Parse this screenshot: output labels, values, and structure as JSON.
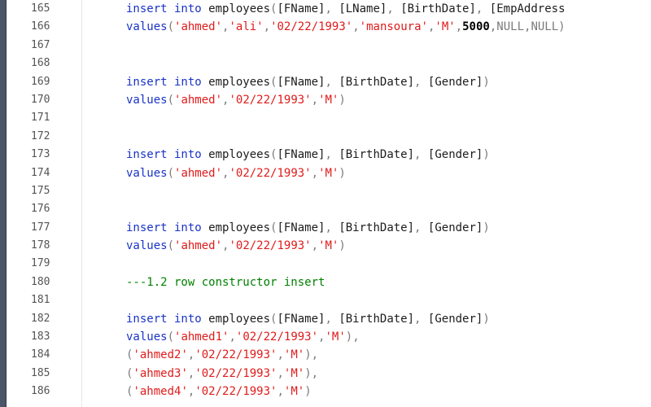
{
  "editor": {
    "lines": [
      {
        "n": "165",
        "tokens": [
          {
            "t": "insert into ",
            "c": "kw"
          },
          {
            "t": "employees",
            "c": "id"
          },
          {
            "t": "(",
            "c": "op"
          },
          {
            "t": "[FName]",
            "c": "id"
          },
          {
            "t": ", ",
            "c": "op"
          },
          {
            "t": "[LName]",
            "c": "id"
          },
          {
            "t": ", ",
            "c": "op"
          },
          {
            "t": "[BirthDate]",
            "c": "id"
          },
          {
            "t": ", ",
            "c": "op"
          },
          {
            "t": "[EmpAddress",
            "c": "id"
          }
        ]
      },
      {
        "n": "166",
        "tokens": [
          {
            "t": "values",
            "c": "kw"
          },
          {
            "t": "(",
            "c": "op"
          },
          {
            "t": "'ahmed'",
            "c": "str"
          },
          {
            "t": ",",
            "c": "op"
          },
          {
            "t": "'ali'",
            "c": "str"
          },
          {
            "t": ",",
            "c": "op"
          },
          {
            "t": "'02/22/1993'",
            "c": "str"
          },
          {
            "t": ",",
            "c": "op"
          },
          {
            "t": "'mansoura'",
            "c": "str"
          },
          {
            "t": ",",
            "c": "op"
          },
          {
            "t": "'M'",
            "c": "str"
          },
          {
            "t": ",",
            "c": "op"
          },
          {
            "t": "5000",
            "c": "num"
          },
          {
            "t": ",",
            "c": "op"
          },
          {
            "t": "NULL",
            "c": "nul"
          },
          {
            "t": ",",
            "c": "op"
          },
          {
            "t": "NULL",
            "c": "nul"
          },
          {
            "t": ")",
            "c": "op"
          }
        ]
      },
      {
        "n": "167",
        "tokens": []
      },
      {
        "n": "168",
        "tokens": []
      },
      {
        "n": "169",
        "tokens": [
          {
            "t": "insert into ",
            "c": "kw"
          },
          {
            "t": "employees",
            "c": "id"
          },
          {
            "t": "(",
            "c": "op"
          },
          {
            "t": "[FName]",
            "c": "id"
          },
          {
            "t": ", ",
            "c": "op"
          },
          {
            "t": "[BirthDate]",
            "c": "id"
          },
          {
            "t": ", ",
            "c": "op"
          },
          {
            "t": "[Gender]",
            "c": "id"
          },
          {
            "t": ")",
            "c": "op"
          }
        ]
      },
      {
        "n": "170",
        "tokens": [
          {
            "t": "values",
            "c": "kw"
          },
          {
            "t": "(",
            "c": "op"
          },
          {
            "t": "'ahmed'",
            "c": "str"
          },
          {
            "t": ",",
            "c": "op"
          },
          {
            "t": "'02/22/1993'",
            "c": "str"
          },
          {
            "t": ",",
            "c": "op"
          },
          {
            "t": "'M'",
            "c": "str"
          },
          {
            "t": ")",
            "c": "op"
          }
        ]
      },
      {
        "n": "171",
        "tokens": []
      },
      {
        "n": "172",
        "tokens": []
      },
      {
        "n": "173",
        "tokens": [
          {
            "t": "insert into ",
            "c": "kw"
          },
          {
            "t": "employees",
            "c": "id"
          },
          {
            "t": "(",
            "c": "op"
          },
          {
            "t": "[FName]",
            "c": "id"
          },
          {
            "t": ", ",
            "c": "op"
          },
          {
            "t": "[BirthDate]",
            "c": "id"
          },
          {
            "t": ", ",
            "c": "op"
          },
          {
            "t": "[Gender]",
            "c": "id"
          },
          {
            "t": ")",
            "c": "op"
          }
        ]
      },
      {
        "n": "174",
        "tokens": [
          {
            "t": "values",
            "c": "kw"
          },
          {
            "t": "(",
            "c": "op"
          },
          {
            "t": "'ahmed'",
            "c": "str"
          },
          {
            "t": ",",
            "c": "op"
          },
          {
            "t": "'02/22/1993'",
            "c": "str"
          },
          {
            "t": ",",
            "c": "op"
          },
          {
            "t": "'M'",
            "c": "str"
          },
          {
            "t": ")",
            "c": "op"
          }
        ]
      },
      {
        "n": "175",
        "tokens": []
      },
      {
        "n": "176",
        "tokens": []
      },
      {
        "n": "177",
        "tokens": [
          {
            "t": "insert into ",
            "c": "kw"
          },
          {
            "t": "employees",
            "c": "id"
          },
          {
            "t": "(",
            "c": "op"
          },
          {
            "t": "[FName]",
            "c": "id"
          },
          {
            "t": ", ",
            "c": "op"
          },
          {
            "t": "[BirthDate]",
            "c": "id"
          },
          {
            "t": ", ",
            "c": "op"
          },
          {
            "t": "[Gender]",
            "c": "id"
          },
          {
            "t": ")",
            "c": "op"
          }
        ]
      },
      {
        "n": "178",
        "tokens": [
          {
            "t": "values",
            "c": "kw"
          },
          {
            "t": "(",
            "c": "op"
          },
          {
            "t": "'ahmed'",
            "c": "str"
          },
          {
            "t": ",",
            "c": "op"
          },
          {
            "t": "'02/22/1993'",
            "c": "str"
          },
          {
            "t": ",",
            "c": "op"
          },
          {
            "t": "'M'",
            "c": "str"
          },
          {
            "t": ")",
            "c": "op"
          }
        ]
      },
      {
        "n": "179",
        "tokens": []
      },
      {
        "n": "180",
        "tokens": [
          {
            "t": "---1.2 row constructor insert",
            "c": "cmt"
          }
        ]
      },
      {
        "n": "181",
        "tokens": []
      },
      {
        "n": "182",
        "tokens": [
          {
            "t": "insert into ",
            "c": "kw"
          },
          {
            "t": "employees",
            "c": "id"
          },
          {
            "t": "(",
            "c": "op"
          },
          {
            "t": "[FName]",
            "c": "id"
          },
          {
            "t": ", ",
            "c": "op"
          },
          {
            "t": "[BirthDate]",
            "c": "id"
          },
          {
            "t": ", ",
            "c": "op"
          },
          {
            "t": "[Gender]",
            "c": "id"
          },
          {
            "t": ")",
            "c": "op"
          }
        ]
      },
      {
        "n": "183",
        "tokens": [
          {
            "t": "values",
            "c": "kw"
          },
          {
            "t": "(",
            "c": "op"
          },
          {
            "t": "'ahmed1'",
            "c": "str"
          },
          {
            "t": ",",
            "c": "op"
          },
          {
            "t": "'02/22/1993'",
            "c": "str"
          },
          {
            "t": ",",
            "c": "op"
          },
          {
            "t": "'M'",
            "c": "str"
          },
          {
            "t": "),",
            "c": "op"
          }
        ]
      },
      {
        "n": "184",
        "tokens": [
          {
            "t": "(",
            "c": "op"
          },
          {
            "t": "'ahmed2'",
            "c": "str"
          },
          {
            "t": ",",
            "c": "op"
          },
          {
            "t": "'02/22/1993'",
            "c": "str"
          },
          {
            "t": ",",
            "c": "op"
          },
          {
            "t": "'M'",
            "c": "str"
          },
          {
            "t": "),",
            "c": "op"
          }
        ]
      },
      {
        "n": "185",
        "tokens": [
          {
            "t": "(",
            "c": "op"
          },
          {
            "t": "'ahmed3'",
            "c": "str"
          },
          {
            "t": ",",
            "c": "op"
          },
          {
            "t": "'02/22/1993'",
            "c": "str"
          },
          {
            "t": ",",
            "c": "op"
          },
          {
            "t": "'M'",
            "c": "str"
          },
          {
            "t": "),",
            "c": "op"
          }
        ]
      },
      {
        "n": "186",
        "tokens": [
          {
            "t": "(",
            "c": "op"
          },
          {
            "t": "'ahmed4'",
            "c": "str"
          },
          {
            "t": ",",
            "c": "op"
          },
          {
            "t": "'02/22/1993'",
            "c": "str"
          },
          {
            "t": ",",
            "c": "op"
          },
          {
            "t": "'M'",
            "c": "str"
          },
          {
            "t": ")",
            "c": "op"
          }
        ]
      }
    ]
  },
  "colors": {
    "keyword": "#1a33c7",
    "string": "#e01b1b",
    "comment": "#008000",
    "operator": "#7a7a7a",
    "null": "#7a7a7a",
    "line_number": "#555555"
  }
}
